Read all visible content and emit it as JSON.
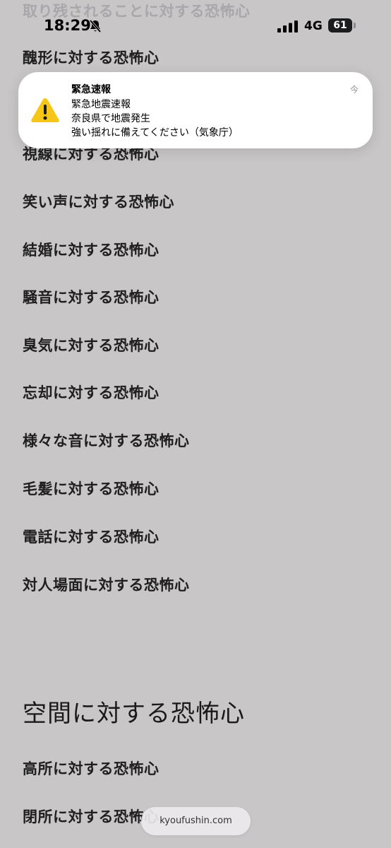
{
  "status_bar": {
    "time": "18:29",
    "network": "4G",
    "battery": "61"
  },
  "notification": {
    "title": "緊急速報",
    "lines": [
      "緊急地震速報",
      "奈良県で地震発生",
      "強い揺れに備えてください（気象庁）"
    ],
    "time": "今"
  },
  "list": {
    "faded_item": "取り残されることに対する恐怖心",
    "items": [
      "醜形に対する恐怖心",
      "視線に対する恐怖心",
      "笑い声に対する恐怖心",
      "結婚に対する恐怖心",
      "騒音に対する恐怖心",
      "臭気に対する恐怖心",
      "忘却に対する恐怖心",
      "様々な音に対する恐怖心",
      "毛髪に対する恐怖心",
      "電話に対する恐怖心",
      "対人場面に対する恐怖心"
    ]
  },
  "section": {
    "heading": "空間に対する恐怖心",
    "items": [
      "高所に対する恐怖心",
      "閉所に対する恐怖心"
    ]
  },
  "browser": {
    "url": "kyoufushin.com"
  }
}
